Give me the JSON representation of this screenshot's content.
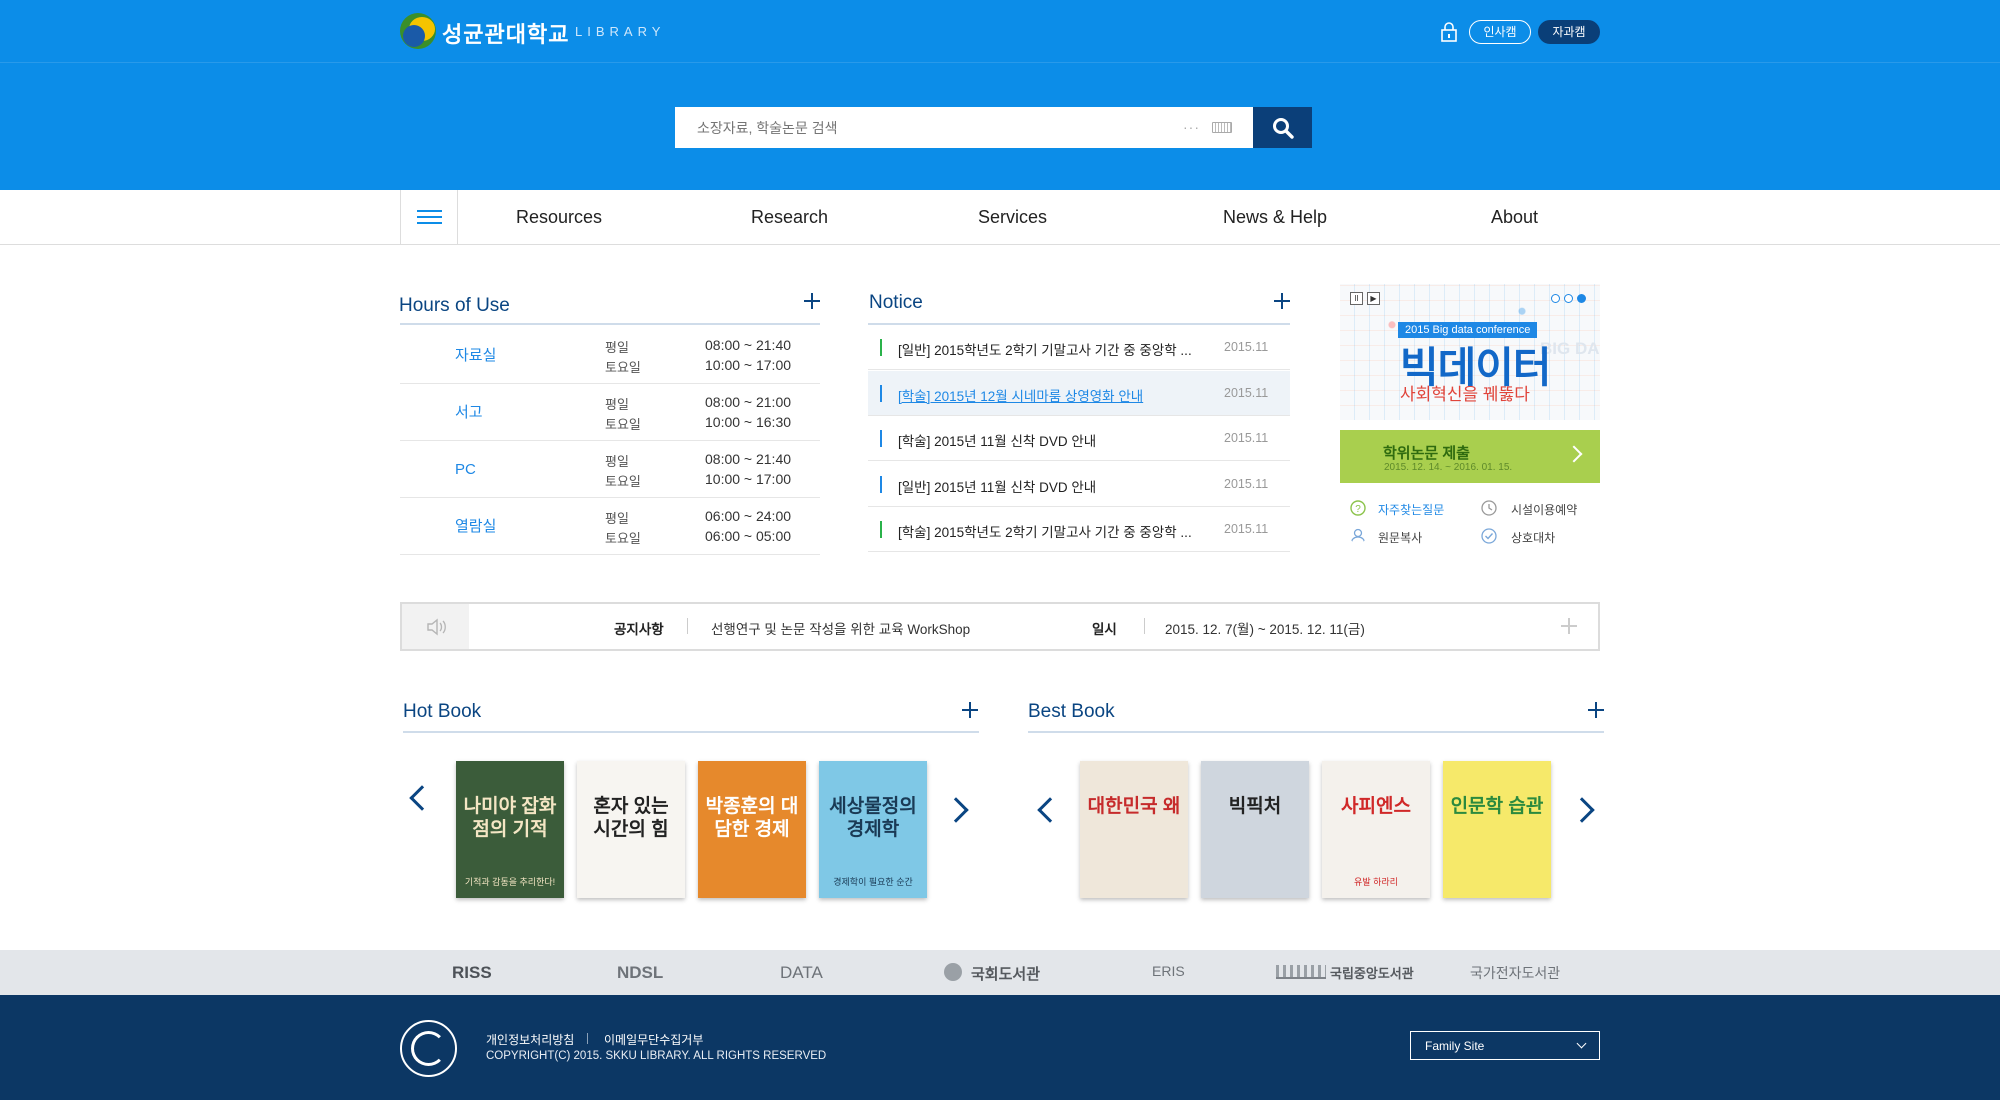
{
  "header": {
    "logo_text": "성균관대학교",
    "logo_sub": "LIBRARY",
    "campus_1": "인사캠",
    "campus_2": "자과캠",
    "colors": {
      "primary": "#0c8de8",
      "dark_navy": "#0b3f79",
      "title": "#0a4582",
      "green": "#a9cf4e"
    }
  },
  "search": {
    "placeholder": "소장자료, 학술논문 검색",
    "button_icon": "search-icon"
  },
  "nav": {
    "menu_icon": "hamburger-icon",
    "items": [
      "Resources",
      "Research",
      "Services",
      "News & Help",
      "About"
    ]
  },
  "hours": {
    "title": "Hours of Use",
    "rows": [
      {
        "place": "자료실",
        "days": [
          "평일",
          "토요일"
        ],
        "times": [
          "08:00 ~ 21:40",
          "10:00 ~ 17:00"
        ]
      },
      {
        "place": "서고",
        "days": [
          "평일",
          "토요일"
        ],
        "times": [
          "08:00 ~ 21:00",
          "10:00 ~ 16:30"
        ]
      },
      {
        "place": "PC",
        "days": [
          "평일",
          "토요일"
        ],
        "times": [
          "08:00 ~ 21:40",
          "10:00 ~ 17:00"
        ]
      },
      {
        "place": "열람실",
        "days": [
          "평일",
          "토요일"
        ],
        "times": [
          "06:00 ~ 24:00",
          "06:00 ~ 05:00"
        ]
      }
    ]
  },
  "notice": {
    "title": "Notice",
    "items": [
      {
        "text": "[일반] 2015학년도 2학기 기말고사 기간 중 중앙학 ...",
        "date": "2015.11",
        "mark": "#2ab24a"
      },
      {
        "text": "[학술] 2015년 12월 시네마룸 상영영화 안내",
        "date": "2015.11",
        "mark": "#1e88e5"
      },
      {
        "text": "[학술] 2015년 11월 신착 DVD 안내",
        "date": "2015.11",
        "mark": "#1e88e5"
      },
      {
        "text": "[일반] 2015년 11월 신착 DVD 안내",
        "date": "2015.11",
        "mark": "#1e88e5"
      },
      {
        "text": "[학술] 2015학년도 2학기 기말고사 기간 중 중앙학 ...",
        "date": "2015.11",
        "mark": "#2ab24a"
      }
    ]
  },
  "banner": {
    "tag": "2015 Big data conference",
    "title": "빅데이터",
    "subtitle": "사회혁신을 꿰뚫다",
    "watermark": "BIG DA",
    "pause": "II",
    "play": "▶"
  },
  "thesis": {
    "title": "학위논문 제출",
    "date": "2015. 12. 14. ~ 2016. 01. 15."
  },
  "quicklinks": [
    {
      "label": "자주찾는질문",
      "icon": "question-icon"
    },
    {
      "label": "시설이용예약",
      "icon": "clock-icon"
    },
    {
      "label": "원문복사",
      "icon": "person-icon"
    },
    {
      "label": "상호대차",
      "icon": "check-icon"
    }
  ],
  "announcement": {
    "label": "공지사항",
    "text": "선행연구 및 논문 작성을 위한 교육 WorkShop",
    "date_label": "일시",
    "date": "2015. 12. 7(월) ~ 2015. 12. 11(금)"
  },
  "hotbook": {
    "title": "Hot Book",
    "books": [
      {
        "title": "나미야 잡화점의 기적",
        "caption": "기적과 감동을 추리한다!",
        "bg": "#3b5c3a",
        "fg": "#f4e6c4"
      },
      {
        "title": "혼자 있는 시간의 힘",
        "caption": "",
        "bg": "#f7f5f1",
        "fg": "#222"
      },
      {
        "title": "박종훈의 대담한 경제",
        "caption": "",
        "bg": "#e6892c",
        "fg": "#fff"
      },
      {
        "title": "세상물정의 경제학",
        "caption": "경제학이 필요한 순간",
        "bg": "#7fc8e6",
        "fg": "#1a3a55"
      }
    ]
  },
  "bestbook": {
    "title": "Best Book",
    "books": [
      {
        "title": "대한민국 왜",
        "caption": "",
        "bg": "#efe7da",
        "fg": "#c62b2b"
      },
      {
        "title": "빅픽처",
        "caption": "",
        "bg": "#cfd6de",
        "fg": "#222"
      },
      {
        "title": "사피엔스",
        "caption": "유발 하라리",
        "bg": "#f4f1ec",
        "fg": "#d02828"
      },
      {
        "title": "인문학 습관",
        "caption": "",
        "bg": "#f6e96a",
        "fg": "#2b8a3e"
      }
    ]
  },
  "partners": [
    "RISS",
    "NDSL",
    "DATA",
    "국회도서관",
    "ERIS",
    "국립중앙도서관",
    "국가전자도서관"
  ],
  "footer": {
    "privacy": "개인정보처리방침",
    "email": "이메일무단수집거부",
    "copyright": "COPYRIGHT(C) 2015. SKKU LIBRARY. ALL RIGHTS RESERVED",
    "family_site": "Family Site"
  }
}
